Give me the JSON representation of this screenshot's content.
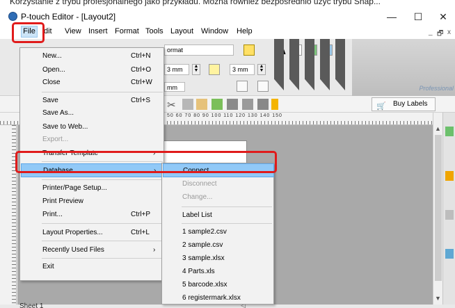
{
  "caption": "Korzystanie z trybu profesjonalnego jako przykładu. Można również bezpośrednio użyć trybu Snap...",
  "window": {
    "title": "P-touch Editor - [Layout2]",
    "minimize": "—",
    "maximize": "☐",
    "close": "✕"
  },
  "menubar": {
    "items": [
      "File",
      "dit",
      "View",
      "Insert",
      "Format",
      "Tools",
      "Layout",
      "Window",
      "Help"
    ],
    "mdi_min": "_",
    "mdi_restore": "🗗",
    "mdi_close": "x"
  },
  "toolbar": {
    "format_box": "ormat",
    "mm1": "3 mm",
    "mm2": "3 mm",
    "mm3": "mm",
    "align_text": "A",
    "professional": "Professional",
    "buy_labels": "Buy Labels"
  },
  "ruler": {
    "numbers": "50  60  70  80  90  100  110  120  130  140  150"
  },
  "status": {
    "sheet": "Sheet 1"
  },
  "file_menu": {
    "new": "New...",
    "new_sc": "Ctrl+N",
    "open": "Open...",
    "open_sc": "Ctrl+O",
    "close": "Close",
    "close_sc": "Ctrl+W",
    "save": "Save",
    "save_sc": "Ctrl+S",
    "save_as": "Save As...",
    "save_web": "Save to Web...",
    "export": "Export...",
    "transfer": "Transfer Template",
    "database": "Database",
    "printer_setup": "Printer/Page Setup...",
    "print_preview": "Print Preview",
    "print": "Print...",
    "print_sc": "Ctrl+P",
    "layout_props": "Layout Properties...",
    "layout_props_sc": "Ctrl+L",
    "recent": "Recently Used Files",
    "exit": "Exit",
    "arrow": "›"
  },
  "database_menu": {
    "connect": "Connect...",
    "disconnect": "Disconnect",
    "change": "Change...",
    "label_list": "Label List",
    "recent_files": [
      "1 sample2.csv",
      "2 sample.csv",
      "3 sample.xlsx",
      "4 Parts.xls",
      "5 barcode.xlsx",
      "6 registermark.xlsx"
    ]
  },
  "colors": {
    "highlight": "#91c9f7",
    "annotation_red": "#e01b1b",
    "menu_bg": "#f2f2f2"
  }
}
